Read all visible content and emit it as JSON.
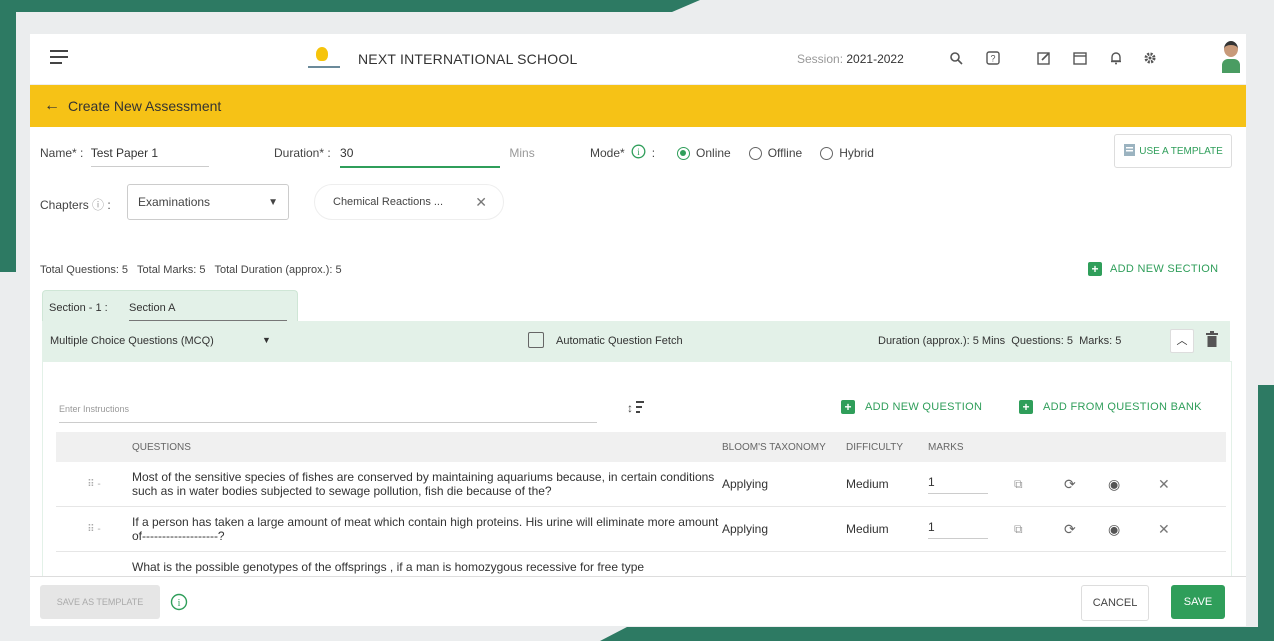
{
  "header": {
    "school_name": "NEXT INTERNATIONAL SCHOOL",
    "session_label": "Session:",
    "session_value": "2021-2022"
  },
  "page": {
    "title": "Create New Assessment"
  },
  "form": {
    "name_label": "Name* :",
    "name_value": "Test Paper 1",
    "duration_label": "Duration* :",
    "duration_value": "30",
    "duration_unit": "Mins",
    "mode_label": "Mode*",
    "mode_options": [
      "Online",
      "Offline",
      "Hybrid"
    ],
    "mode_selected": "Online",
    "use_template": "USE A TEMPLATE",
    "chapters_label": "Chapters",
    "chapters_select": "Examinations",
    "chapter_chip": "Chemical Reactions ..."
  },
  "totals": {
    "text": "Total Questions: 5   Total Marks: 5   Total Duration (approx.): 5",
    "add_section": "ADD NEW SECTION"
  },
  "section": {
    "label": "Section - 1 :",
    "name": "Section A",
    "type": "Multiple Choice Questions (MCQ)",
    "auto_fetch": "Automatic Question Fetch",
    "summary": "Duration (approx.): 5 Mins  Questions: 5  Marks: 5",
    "instructions_placeholder": "Enter Instructions",
    "add_question": "ADD NEW QUESTION",
    "add_from_bank": "ADD FROM QUESTION BANK"
  },
  "table": {
    "headers": [
      "QUESTIONS",
      "BLOOM'S TAXONOMY",
      "DIFFICULTY",
      "MARKS"
    ],
    "rows": [
      {
        "question": "Most of the sensitive species of fishes are conserved by maintaining aquariums because, in certain conditions such as in water bodies subjected to sewage pollution, fish die because of the?",
        "bloom": "Applying",
        "difficulty": "Medium",
        "marks": "1"
      },
      {
        "question": "If a person has taken a large amount of meat which contain high proteins. His urine will eliminate more amount of-------------------?",
        "bloom": "Applying",
        "difficulty": "Medium",
        "marks": "1"
      },
      {
        "question": "What is the possible genotypes of the offsprings , if a man is homozygous recessive for free type",
        "bloom": "",
        "difficulty": "",
        "marks": ""
      }
    ]
  },
  "footer": {
    "save_template": "SAVE AS TEMPLATE",
    "cancel": "CANCEL",
    "save": "SAVE"
  },
  "colors": {
    "accent": "#f6c216",
    "green": "#2f9e5a",
    "section_bg": "#e3f1e8",
    "frame": "#2d7a63"
  },
  "icons": [
    "menu-icon",
    "search-icon",
    "help-icon",
    "edit-icon",
    "calendar-icon",
    "bell-icon",
    "gear-icon",
    "info-icon",
    "sort-icon",
    "drag-icon",
    "copy-icon",
    "refresh-icon",
    "eye-icon",
    "close-icon",
    "chevron-up-icon",
    "trash-icon",
    "template-icon"
  ]
}
